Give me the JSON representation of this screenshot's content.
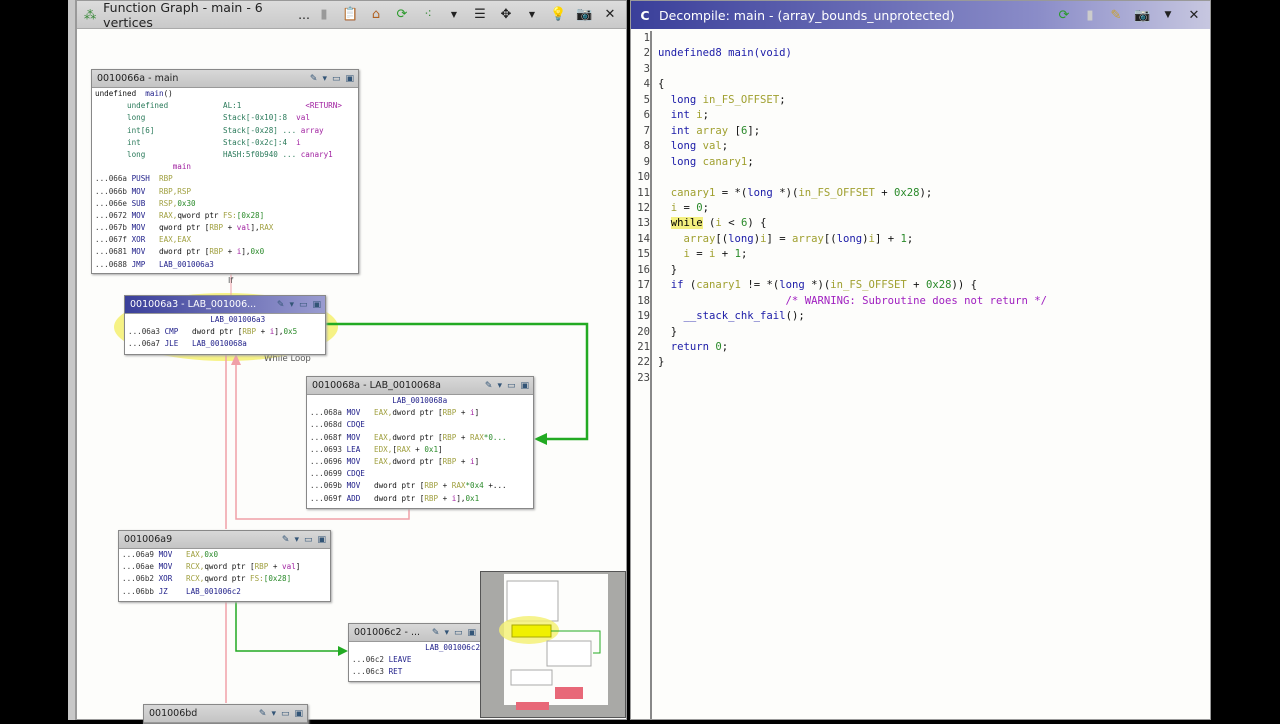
{
  "graph_panel": {
    "title": "Function Graph - main - 6 vertices",
    "ellipsis": "...",
    "labels": {
      "if": "If",
      "while_loop": "While Loop"
    },
    "blocks": [
      {
        "id": "b1",
        "title": "0010066a - main",
        "lines": [
          [
            [
              "undefined  ",
              "t"
            ],
            [
              "main",
              "l"
            ],
            [
              "()",
              "t"
            ]
          ],
          [
            [
              "       undefined            AL:1              ",
              "f"
            ],
            [
              "<RETURN>",
              "v"
            ]
          ],
          [
            [
              "       long                 Stack[-0x10]:8  ",
              "f"
            ],
            [
              "val",
              "v"
            ]
          ],
          [
            [
              "       int[6]               Stack[-0x28] ... ",
              "f"
            ],
            [
              "array",
              "v"
            ]
          ],
          [
            [
              "       int                  Stack[-0x2c]:4  ",
              "f"
            ],
            [
              "i",
              "v"
            ]
          ],
          [
            [
              "       long                 HASH:5f0b940 ... ",
              "f"
            ],
            [
              "canary1",
              "v"
            ]
          ],
          [
            [
              "                 main",
              "v"
            ]
          ],
          [
            [
              "...066a ",
              "a"
            ],
            [
              "PUSH  ",
              "m"
            ],
            [
              "RBP",
              "r"
            ]
          ],
          [
            [
              "...066b ",
              "a"
            ],
            [
              "MOV   ",
              "m"
            ],
            [
              "RBP,RSP",
              "r"
            ]
          ],
          [
            [
              "...066e ",
              "a"
            ],
            [
              "SUB   ",
              "m"
            ],
            [
              "RSP,",
              "r"
            ],
            [
              "0x30",
              "n"
            ]
          ],
          [
            [
              "...0672 ",
              "a"
            ],
            [
              "MOV   ",
              "m"
            ],
            [
              "RAX,",
              "r"
            ],
            [
              "qword ptr ",
              "t"
            ],
            [
              "FS:",
              "r"
            ],
            [
              "[0x28]",
              "n"
            ]
          ],
          [
            [
              "...067b ",
              "a"
            ],
            [
              "MOV   ",
              "m"
            ],
            [
              "qword ptr [",
              "t"
            ],
            [
              "RBP",
              "r"
            ],
            [
              " + ",
              "t"
            ],
            [
              "val",
              "v"
            ],
            [
              "],",
              "t"
            ],
            [
              "RAX",
              "r"
            ]
          ],
          [
            [
              "...067f ",
              "a"
            ],
            [
              "XOR   ",
              "m"
            ],
            [
              "EAX,EAX",
              "r"
            ]
          ],
          [
            [
              "...0681 ",
              "a"
            ],
            [
              "MOV   ",
              "m"
            ],
            [
              "dword ptr [",
              "t"
            ],
            [
              "RBP",
              "r"
            ],
            [
              " + ",
              "t"
            ],
            [
              "i",
              "v"
            ],
            [
              "],",
              "t"
            ],
            [
              "0x0",
              "n"
            ]
          ],
          [
            [
              "...0688 ",
              "a"
            ],
            [
              "JMP   ",
              "m"
            ],
            [
              "LAB_001006a3",
              "l"
            ]
          ]
        ]
      },
      {
        "id": "b2",
        "title": "001006a3 - LAB_001006...",
        "selected": true,
        "lines": [
          [
            [
              "                  LAB_001006a3",
              "l"
            ]
          ],
          [
            [
              "...06a3 ",
              "a"
            ],
            [
              "CMP   ",
              "m"
            ],
            [
              "dword ptr [",
              "t"
            ],
            [
              "RBP",
              "r"
            ],
            [
              " + ",
              "t"
            ],
            [
              "i",
              "v"
            ],
            [
              "],",
              "t"
            ],
            [
              "0x5",
              "n"
            ]
          ],
          [
            [
              "...06a7 ",
              "a"
            ],
            [
              "JLE   ",
              "m"
            ],
            [
              "LAB_0010068a",
              "l"
            ]
          ]
        ]
      },
      {
        "id": "b3",
        "title": "0010068a - LAB_0010068a",
        "lines": [
          [
            [
              "                  LAB_0010068a",
              "l"
            ]
          ],
          [
            [
              "...068a ",
              "a"
            ],
            [
              "MOV   ",
              "m"
            ],
            [
              "EAX,",
              "r"
            ],
            [
              "dword ptr [",
              "t"
            ],
            [
              "RBP",
              "r"
            ],
            [
              " + ",
              "t"
            ],
            [
              "i",
              "v"
            ],
            [
              "]",
              "t"
            ]
          ],
          [
            [
              "...068d ",
              "a"
            ],
            [
              "CDQE",
              "m"
            ]
          ],
          [
            [
              "...068f ",
              "a"
            ],
            [
              "MOV   ",
              "m"
            ],
            [
              "EAX,",
              "r"
            ],
            [
              "dword ptr [",
              "t"
            ],
            [
              "RBP",
              "r"
            ],
            [
              " + ",
              "t"
            ],
            [
              "RAX",
              "r"
            ],
            [
              "*0...",
              "n"
            ]
          ],
          [
            [
              "...0693 ",
              "a"
            ],
            [
              "LEA   ",
              "m"
            ],
            [
              "EDX,",
              "r"
            ],
            [
              "[",
              "t"
            ],
            [
              "RAX",
              "r"
            ],
            [
              " + ",
              "t"
            ],
            [
              "0x1",
              "n"
            ],
            [
              "]",
              "t"
            ]
          ],
          [
            [
              "...0696 ",
              "a"
            ],
            [
              "MOV   ",
              "m"
            ],
            [
              "EAX,",
              "r"
            ],
            [
              "dword ptr [",
              "t"
            ],
            [
              "RBP",
              "r"
            ],
            [
              " + ",
              "t"
            ],
            [
              "i",
              "v"
            ],
            [
              "]",
              "t"
            ]
          ],
          [
            [
              "...0699 ",
              "a"
            ],
            [
              "CDQE",
              "m"
            ]
          ],
          [
            [
              "...069b ",
              "a"
            ],
            [
              "MOV   ",
              "m"
            ],
            [
              "dword ptr [",
              "t"
            ],
            [
              "RBP",
              "r"
            ],
            [
              " + ",
              "t"
            ],
            [
              "RAX",
              "r"
            ],
            [
              "*0x4",
              "n"
            ],
            [
              " +...",
              "t"
            ]
          ],
          [
            [
              "...069f ",
              "a"
            ],
            [
              "ADD   ",
              "m"
            ],
            [
              "dword ptr [",
              "t"
            ],
            [
              "RBP",
              "r"
            ],
            [
              " + ",
              "t"
            ],
            [
              "i",
              "v"
            ],
            [
              "],",
              "t"
            ],
            [
              "0x1",
              "n"
            ]
          ]
        ]
      },
      {
        "id": "b4",
        "title": "001006a9",
        "lines": [
          [
            [
              "...06a9 ",
              "a"
            ],
            [
              "MOV   ",
              "m"
            ],
            [
              "EAX,",
              "r"
            ],
            [
              "0x0",
              "n"
            ]
          ],
          [
            [
              "...06ae ",
              "a"
            ],
            [
              "MOV   ",
              "m"
            ],
            [
              "RCX,",
              "r"
            ],
            [
              "qword ptr [",
              "t"
            ],
            [
              "RBP",
              "r"
            ],
            [
              " + ",
              "t"
            ],
            [
              "val",
              "v"
            ],
            [
              "]",
              "t"
            ]
          ],
          [
            [
              "...06b2 ",
              "a"
            ],
            [
              "XOR   ",
              "m"
            ],
            [
              "RCX,",
              "r"
            ],
            [
              "qword ptr ",
              "t"
            ],
            [
              "FS:",
              "r"
            ],
            [
              "[0x28]",
              "n"
            ]
          ],
          [
            [
              "...06bb ",
              "a"
            ],
            [
              "JZ    ",
              "m"
            ],
            [
              "LAB_001006c2",
              "l"
            ]
          ]
        ]
      },
      {
        "id": "b5",
        "title": "001006c2 - ...",
        "lines": [
          [
            [
              "                LAB_001006c2",
              "l"
            ]
          ],
          [
            [
              "...06c2 ",
              "a"
            ],
            [
              "LEAVE",
              "m"
            ]
          ],
          [
            [
              "...06c3 ",
              "a"
            ],
            [
              "RET",
              "m"
            ]
          ]
        ]
      },
      {
        "id": "b6",
        "title": "001006bd",
        "lines": []
      }
    ]
  },
  "decompile_panel": {
    "title": "Decompile: main -  (array_bounds_unprotected)",
    "lines": [
      [],
      [
        [
          "undefined8 main(void)",
          "kw"
        ]
      ],
      [],
      [
        [
          "{",
          "dp"
        ]
      ],
      [
        [
          "  long ",
          "kw"
        ],
        [
          "in_FS_OFFSET",
          "dv"
        ],
        [
          ";",
          "dp"
        ]
      ],
      [
        [
          "  int ",
          "kw"
        ],
        [
          "i",
          "dv"
        ],
        [
          ";",
          "dp"
        ]
      ],
      [
        [
          "  int ",
          "kw"
        ],
        [
          "array ",
          "dv"
        ],
        [
          "[",
          "dp"
        ],
        [
          "6",
          "dn"
        ],
        [
          "];",
          "dp"
        ]
      ],
      [
        [
          "  long ",
          "kw"
        ],
        [
          "val",
          "dv"
        ],
        [
          ";",
          "dp"
        ]
      ],
      [
        [
          "  long ",
          "kw"
        ],
        [
          "canary1",
          "dv"
        ],
        [
          ";",
          "dp"
        ]
      ],
      [],
      [
        [
          "  canary1",
          "dv"
        ],
        [
          " = *(",
          "dp"
        ],
        [
          "long",
          "kw"
        ],
        [
          " *)(",
          "dp"
        ],
        [
          "in_FS_OFFSET",
          "dv"
        ],
        [
          " + ",
          "dp"
        ],
        [
          "0x28",
          "dn"
        ],
        [
          ");",
          "dp"
        ]
      ],
      [
        [
          "  i",
          "dv"
        ],
        [
          " = ",
          "dp"
        ],
        [
          "0",
          "dn"
        ],
        [
          ";",
          "dp"
        ]
      ],
      [
        [
          "  ",
          "dp"
        ],
        [
          "while",
          "hl"
        ],
        [
          " (",
          "dp"
        ],
        [
          "i",
          "dv"
        ],
        [
          " < ",
          "dp"
        ],
        [
          "6",
          "dn"
        ],
        [
          ") {",
          "dp"
        ]
      ],
      [
        [
          "    array",
          "dv"
        ],
        [
          "[(",
          "dp"
        ],
        [
          "long",
          "kw"
        ],
        [
          ")",
          "dp"
        ],
        [
          "i",
          "dv"
        ],
        [
          "] = ",
          "dp"
        ],
        [
          "array",
          "dv"
        ],
        [
          "[(",
          "dp"
        ],
        [
          "long",
          "kw"
        ],
        [
          ")",
          "dp"
        ],
        [
          "i",
          "dv"
        ],
        [
          "] + ",
          "dp"
        ],
        [
          "1",
          "dn"
        ],
        [
          ";",
          "dp"
        ]
      ],
      [
        [
          "    i",
          "dv"
        ],
        [
          " = ",
          "dp"
        ],
        [
          "i",
          "dv"
        ],
        [
          " + ",
          "dp"
        ],
        [
          "1",
          "dn"
        ],
        [
          ";",
          "dp"
        ]
      ],
      [
        [
          "  }",
          "dp"
        ]
      ],
      [
        [
          "  if",
          "kw"
        ],
        [
          " (",
          "dp"
        ],
        [
          "canary1",
          "dv"
        ],
        [
          " != *(",
          "dp"
        ],
        [
          "long",
          "kw"
        ],
        [
          " *)(",
          "dp"
        ],
        [
          "in_FS_OFFSET",
          "dv"
        ],
        [
          " + ",
          "dp"
        ],
        [
          "0x28",
          "dn"
        ],
        [
          ")) {",
          "dp"
        ]
      ],
      [
        [
          "                    /* WARNING: Subroutine does not return */",
          "dc"
        ]
      ],
      [
        [
          "    __stack_chk_fail",
          "kw"
        ],
        [
          "();",
          "dp"
        ]
      ],
      [
        [
          "  }",
          "dp"
        ]
      ],
      [
        [
          "  return ",
          "kw"
        ],
        [
          "0",
          "dn"
        ],
        [
          ";",
          "dp"
        ]
      ],
      [
        [
          "}",
          "dp"
        ]
      ],
      []
    ]
  },
  "colors": {
    "selection_highlight": "#f4f080",
    "true_edge": "#22aa22",
    "false_edge": "#f0a0a8",
    "pane_title_active": "#3a3f9a"
  }
}
